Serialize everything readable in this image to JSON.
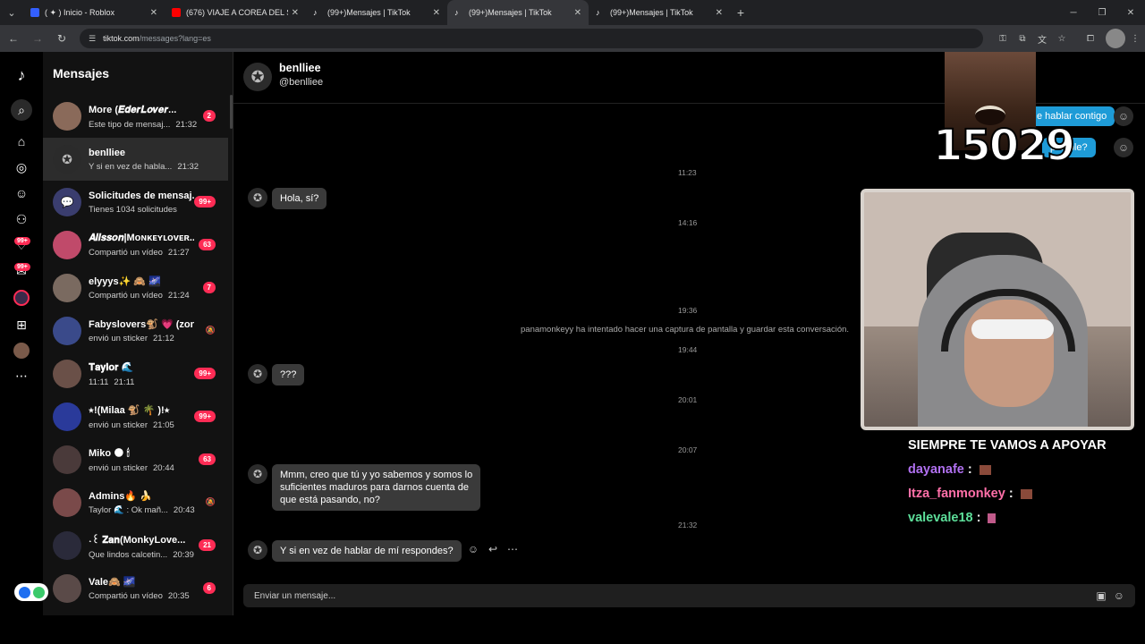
{
  "browser": {
    "tabs": [
      {
        "title": "( ✦ ) Inicio - Roblox",
        "favicon_color": "#335fff"
      },
      {
        "title": "(676) VIAJE A COREA DEL SUR",
        "favicon_color": "#ff0000"
      },
      {
        "title": "(99+)Mensajes | TikTok",
        "favicon_color": "#000000"
      },
      {
        "title": "(99+)Mensajes | TikTok",
        "favicon_color": "#000000"
      },
      {
        "title": "(99+)Mensajes | TikTok",
        "favicon_color": "#000000"
      }
    ],
    "active_tab_index": 3,
    "url_domain": "tiktok.com",
    "url_path": "/messages?lang=es"
  },
  "rail": {
    "badges": [
      "99+",
      "99+"
    ]
  },
  "sidebar": {
    "title": "Mensajes",
    "conversations": [
      {
        "name": "ັ້ິMore (𝑬𝒅𝒆𝒓𝑳𝒐𝒗𝒆𝒓...",
        "preview": "Este tipo de mensaj...",
        "time": "21:32",
        "badge": "2",
        "avatar_color": "#8a6a5a"
      },
      {
        "name": "benlliee",
        "preview": "Y si en vez de habla...",
        "time": "21:32",
        "badge": "",
        "avatar_color": "#2b2b2b"
      },
      {
        "name": "Solicitudes de mensaj...",
        "preview": "Tienes 1034 solicitudes",
        "time": "",
        "badge": "99+",
        "avatar_color": "#3a3d6e"
      },
      {
        "name": "𝑨𝒍𝒊𝒔𝒔𝒐𝒏|Mᴏɴᴋᴇʏʟᴏᴠᴇʀ...",
        "preview": "Compartió un vídeo",
        "time": "21:27",
        "badge": "63",
        "avatar_color": "#c04a6a"
      },
      {
        "name": "elyyys✨ 🙈 🌌",
        "preview": "Compartió un vídeo",
        "time": "21:24",
        "badge": "7",
        "avatar_color": "#7a6a60"
      },
      {
        "name": "Fabyslovers🐒 💗 (zon...",
        "preview": "envió un sticker",
        "time": "21:12",
        "badge": "",
        "muted": true,
        "avatar_color": "#3a4a8a"
      },
      {
        "name": "𝐓𝐚𝐲𝐥𝐨𝐫 🌊",
        "preview": "11:11",
        "time": "21:11",
        "badge": "99+",
        "avatar_color": "#6a5048"
      },
      {
        "name": "⭑!(Milaa 🐒 🌴 )!⭑",
        "preview": "envió un sticker",
        "time": "21:05",
        "badge": "99+",
        "avatar_color": "#2a3a9a"
      },
      {
        "name": "Miko 🌑 🕯",
        "preview": "envió un sticker",
        "time": "20:44",
        "badge": "63",
        "avatar_color": "#4a3a3a"
      },
      {
        "name": "Admins🔥 🍌",
        "preview": "Taylor 🌊 : Ok mañ...",
        "time": "20:43",
        "badge": "",
        "muted": true,
        "avatar_color": "#7a4a4a"
      },
      {
        "name": "˖꒰ 𝐙𝐚𝐧(MonkyLove...",
        "preview": "Que lindos calcetin...",
        "time": "20:39",
        "badge": "21",
        "avatar_color": "#2a2a3a"
      },
      {
        "name": "Vale🙈 🌌",
        "preview": "Compartió un vídeo",
        "time": "20:35",
        "badge": "6",
        "avatar_color": "#5a4a48"
      }
    ]
  },
  "chat": {
    "name": "benlliee",
    "handle": "@benlliee",
    "timestamps": [
      "11:23",
      "14:16",
      "19:36",
      "19:44",
      "20:01",
      "20:07",
      "21:32"
    ],
    "system_message": "panamonkeyy ha intentado hacer una captura de pantalla y guardar esta conversación.",
    "messages": [
      {
        "text": "Hola, sí?"
      },
      {
        "text": "???"
      },
      {
        "text_lines": [
          "Mmm, creo que tú y yo sabemos y somos lo",
          "suficientes maduros para darnos cuenta de",
          "que está pasando, no?"
        ]
      },
      {
        "text": "Y si en vez de hablar de mí respondes?"
      }
    ],
    "sent_partial": [
      "e hablar contigo",
      "ponible?"
    ],
    "composer_placeholder": "Enviar un mensaje..."
  },
  "stream_overlay": {
    "counter": "15029",
    "chat_header": "SIEMPRE TE VAMOS A APOYAR",
    "chat_lines": [
      {
        "user": "dayanafe",
        "sep": " : "
      },
      {
        "user": "Itza_fanmonkey",
        "sep": " : "
      },
      {
        "user": "valevale18",
        "sep": " : "
      }
    ]
  }
}
